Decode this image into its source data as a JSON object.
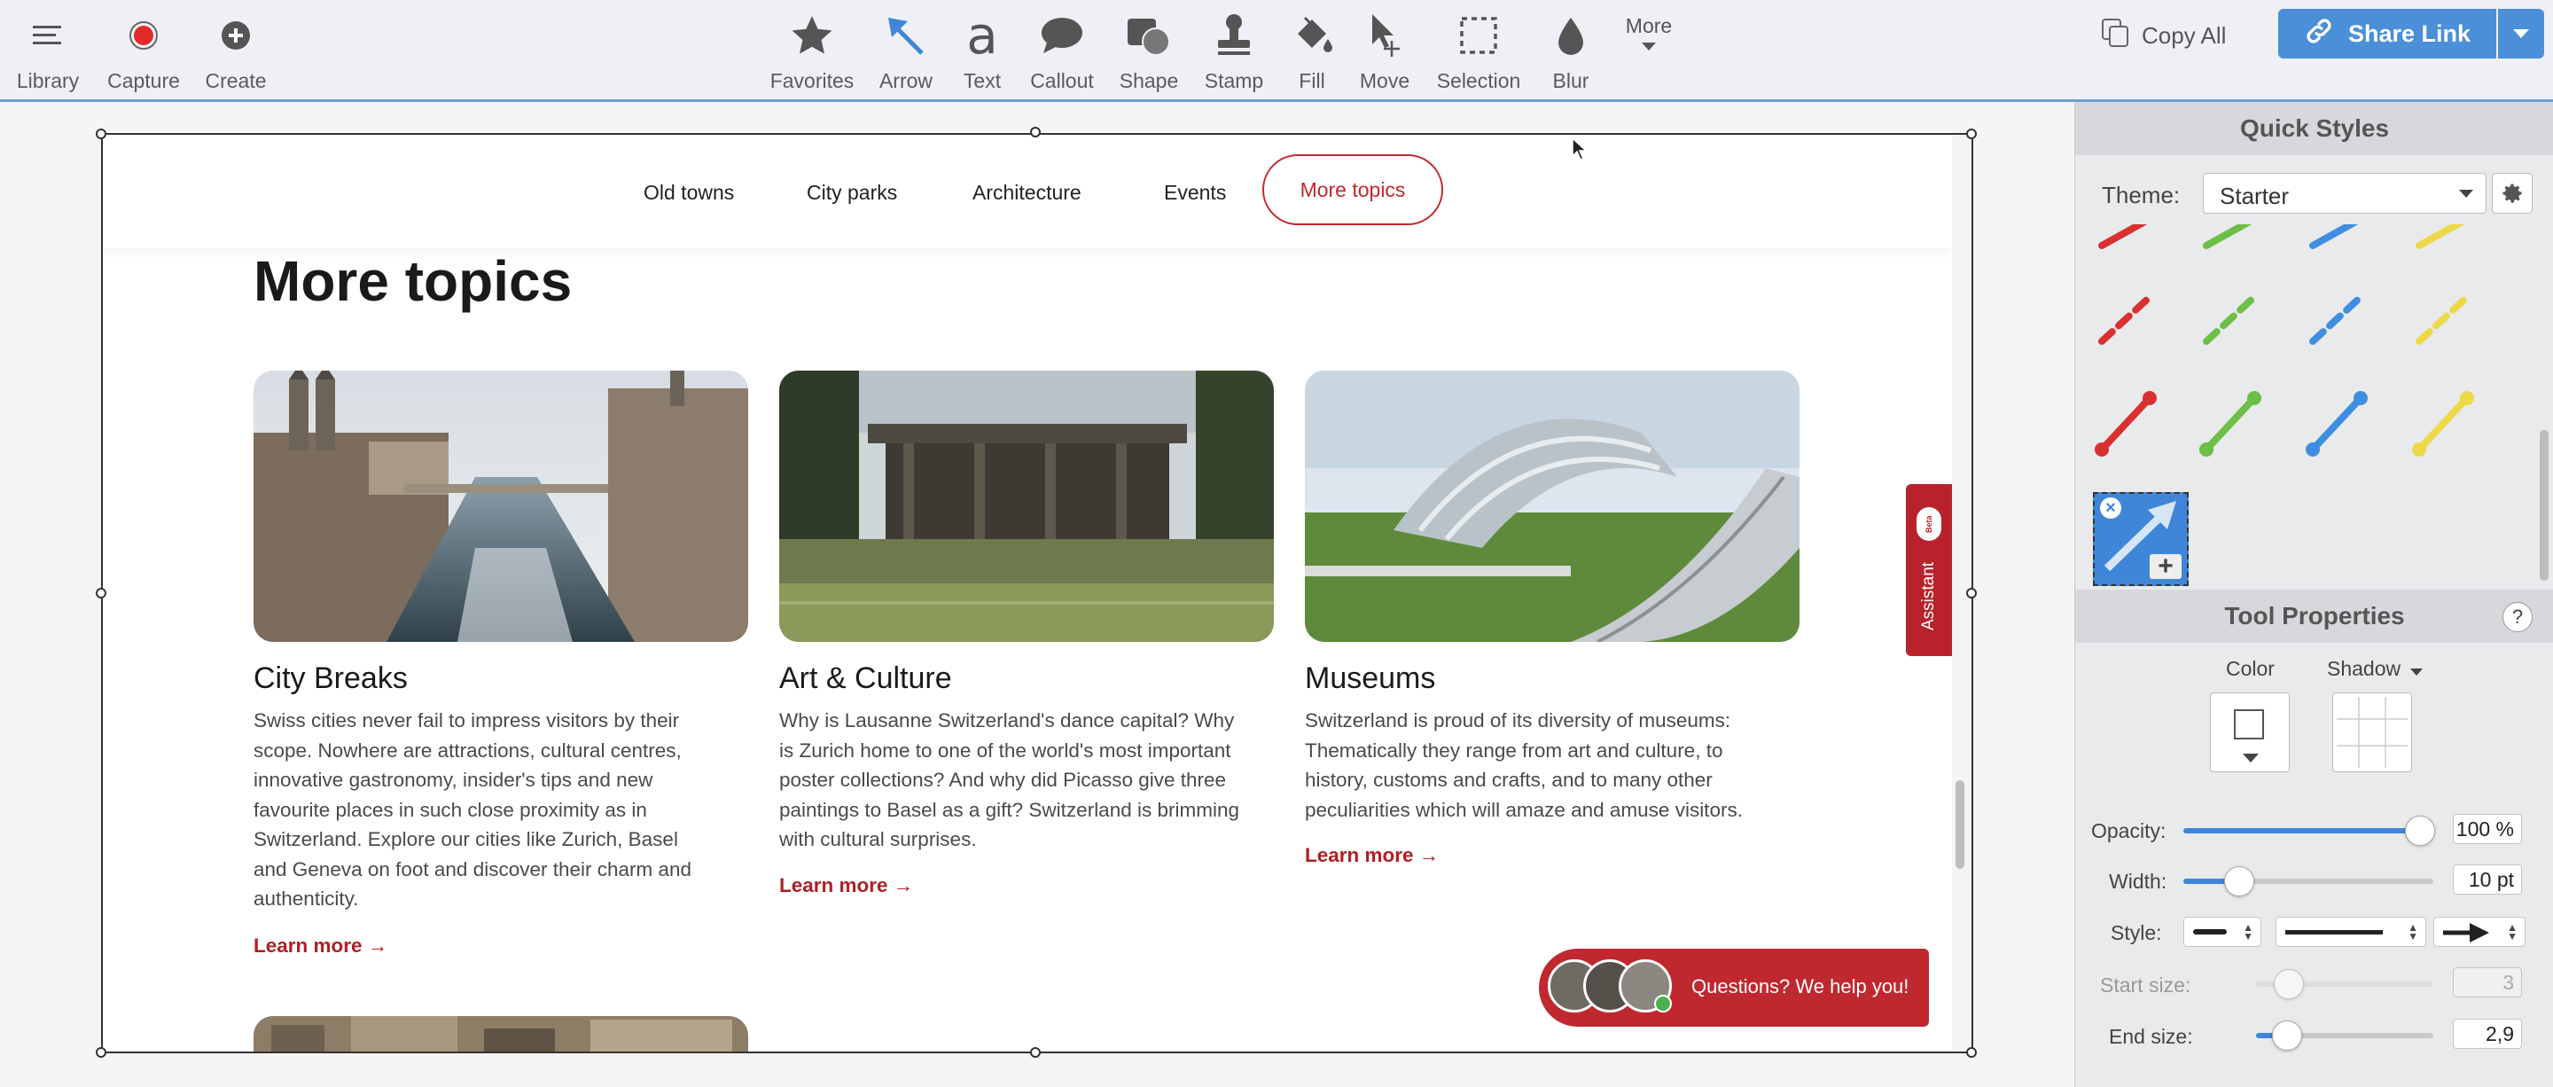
{
  "toolbar": {
    "left": [
      {
        "label": "Library",
        "icon": "menu-icon"
      },
      {
        "label": "Capture",
        "icon": "record-icon"
      },
      {
        "label": "Create",
        "icon": "plus-circle-icon"
      }
    ],
    "tools": [
      {
        "label": "Favorites",
        "icon": "star-icon"
      },
      {
        "label": "Arrow",
        "icon": "arrow-icon"
      },
      {
        "label": "Text",
        "icon": "text-icon"
      },
      {
        "label": "Callout",
        "icon": "callout-icon"
      },
      {
        "label": "Shape",
        "icon": "shape-icon"
      },
      {
        "label": "Stamp",
        "icon": "stamp-icon"
      },
      {
        "label": "Fill",
        "icon": "fill-icon"
      },
      {
        "label": "Move",
        "icon": "move-icon"
      },
      {
        "label": "Selection",
        "icon": "selection-icon"
      },
      {
        "label": "Blur",
        "icon": "blur-icon"
      },
      {
        "label": "More",
        "icon": "chevron-down-icon"
      }
    ],
    "copy_all": "Copy All",
    "share_link": "Share Link"
  },
  "webpage": {
    "nav": [
      "Old towns",
      "City parks",
      "Architecture",
      "Events"
    ],
    "nav_active": "More topics",
    "heading": "More topics",
    "cards": [
      {
        "title": "City Breaks",
        "desc": "Swiss cities never fail to impress visitors by their scope. Nowhere are attractions, cultural centres, innovative gastronomy, insider's tips and new favourite places in such close proximity as in Switzerland. Explore our cities like Zurich, Basel and Geneva on foot and discover their charm and authenticity.",
        "link": "Learn more →"
      },
      {
        "title": "Art & Culture",
        "desc": "Why is Lausanne Switzerland's dance capital? Why is Zurich home to one of the world's most important poster collections? And why did Picasso give three paintings to Basel as a gift? Switzerland is brimming with cultural surprises.",
        "link": "Learn more →"
      },
      {
        "title": "Museums",
        "desc": "Switzerland is proud of its diversity of museums: Thematically they range from art and culture, to history, customs and crafts, and to many other peculiarities which will amaze and amuse visitors.",
        "link": "Learn more →"
      }
    ],
    "assistant": "Assistant",
    "assistant_badge": "Beta",
    "chat": "Questions? We help you!"
  },
  "panel": {
    "quick_styles": "Quick Styles",
    "theme_label": "Theme:",
    "theme_value": "Starter",
    "tool_properties": "Tool Properties",
    "help": "?",
    "color_label": "Color",
    "shadow_label": "Shadow",
    "opacity_label": "Opacity:",
    "opacity_value": "100 %",
    "opacity": 1.0,
    "width_label": "Width:",
    "width_value": "10 pt",
    "style_label": "Style:",
    "start_size_label": "Start size:",
    "start_size_value": "3",
    "end_size_label": "End size:",
    "end_size_value": "2,9",
    "style_colors": [
      "#d93030",
      "#6cbf47",
      "#3f8ee0",
      "#ecd948"
    ]
  }
}
